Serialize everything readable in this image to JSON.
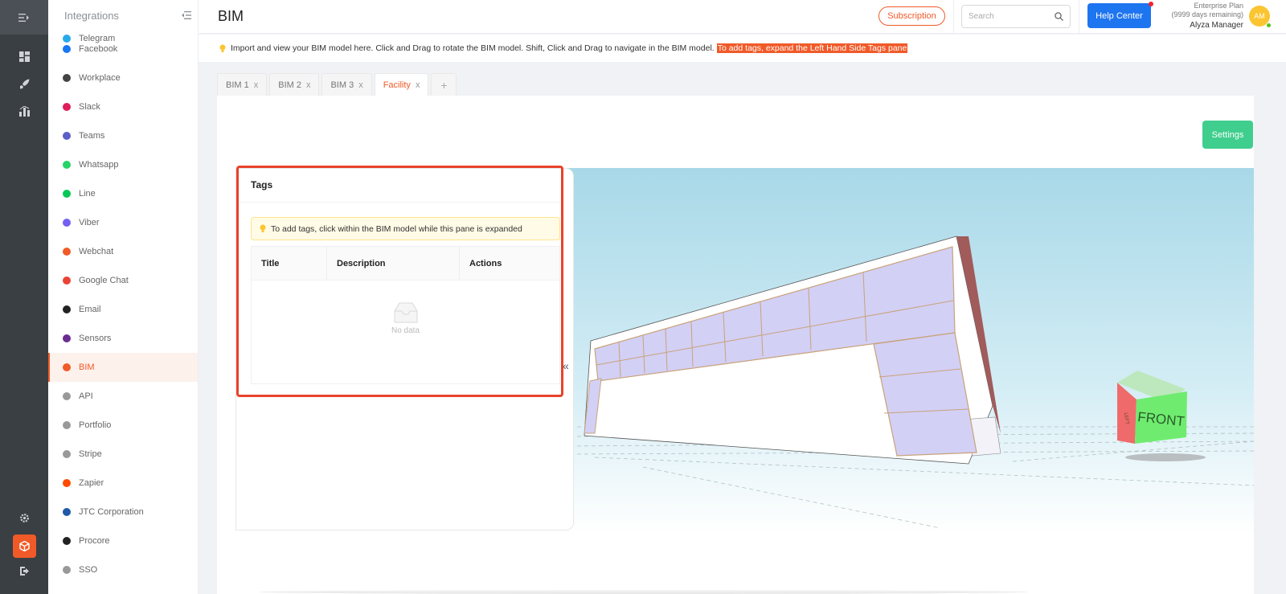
{
  "rail": {
    "icons": [
      "menu-expand-icon",
      "dashboard-icon",
      "rocket-icon",
      "chart-icon",
      "settings-icon",
      "bim-cube-icon",
      "logout-icon"
    ]
  },
  "sidebar": {
    "title": "Integrations",
    "partial_item": "Telegram",
    "items": [
      {
        "label": "Facebook",
        "color": "#1877f2"
      },
      {
        "label": "Workplace",
        "color": "#444444"
      },
      {
        "label": "Slack",
        "color": "#e01e5a"
      },
      {
        "label": "Teams",
        "color": "#5b5fc7"
      },
      {
        "label": "Whatsapp",
        "color": "#25d366"
      },
      {
        "label": "Line",
        "color": "#06c755"
      },
      {
        "label": "Viber",
        "color": "#7360f2"
      },
      {
        "label": "Webchat",
        "color": "#f05a28"
      },
      {
        "label": "Google Chat",
        "color": "#ea4335"
      },
      {
        "label": "Email",
        "color": "#222222"
      },
      {
        "label": "Sensors",
        "color": "#6a2c91"
      },
      {
        "label": "BIM",
        "color": "#f05a28",
        "active": true
      },
      {
        "label": "API",
        "color": "#999999"
      },
      {
        "label": "Portfolio",
        "color": "#999999"
      },
      {
        "label": "Stripe",
        "color": "#999999"
      },
      {
        "label": "Zapier",
        "color": "#ff4a00"
      },
      {
        "label": "JTC Corporation",
        "color": "#1e5aa8"
      },
      {
        "label": "Procore",
        "color": "#222222"
      },
      {
        "label": "SSO",
        "color": "#999999"
      }
    ]
  },
  "header": {
    "title": "BIM",
    "subscription": "Subscription",
    "search_placeholder": "Search",
    "help": "Help Center",
    "plan_line1": "Enterprise Plan",
    "plan_line2": "(9999 days remaining)",
    "user": "Alyza Manager",
    "avatar": "AM"
  },
  "info": {
    "text": "Import and view your BIM model here. Click and Drag to rotate the BIM model. Shift, Click and Drag to navigate in the BIM model.",
    "highlight": "To add tags, expand the Left Hand Side Tags pane"
  },
  "tabs": [
    {
      "label": "BIM 1",
      "active": false
    },
    {
      "label": "BIM 2",
      "active": false
    },
    {
      "label": "BIM 3",
      "active": false
    },
    {
      "label": "Facility",
      "active": true
    }
  ],
  "tab_close": "x",
  "tab_add": "+",
  "settings": "Settings",
  "tags": {
    "title": "Tags",
    "alert": "To add tags, click within the BIM model while this pane is expanded",
    "columns": [
      "Title",
      "Description",
      "Actions"
    ],
    "empty": "No data",
    "collapse": "«"
  },
  "viewer": {
    "cube_front": "FRONT",
    "cube_left": "LEFT"
  },
  "colors": {
    "accent": "#f05a28",
    "primary": "#1e75f0",
    "success": "#3fce8d"
  }
}
